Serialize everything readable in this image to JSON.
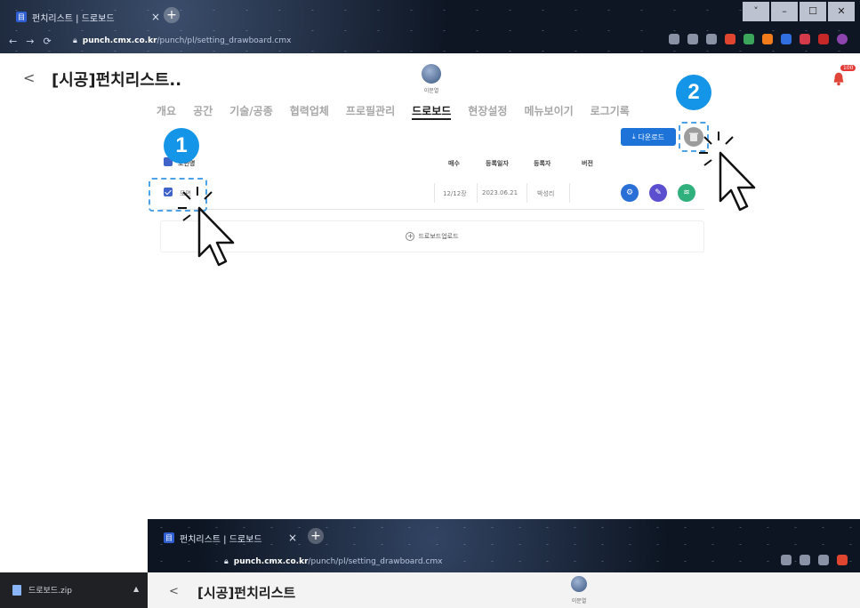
{
  "browser": {
    "tab_title": "펀치리스트 | 드로보드",
    "tab_close": "×",
    "new_tab": "+",
    "url_host": "punch.cmx.co.kr",
    "url_path": "/punch/pl/setting_drawboard.cmx",
    "window_controls": [
      "˅",
      "–",
      "☐",
      "✕"
    ]
  },
  "header": {
    "back": "<",
    "title": "[시공]펀치리스트..",
    "avatar_label": "이문열",
    "notification_badge": "100"
  },
  "tabs": [
    "개요",
    "공간",
    "기술/공종",
    "협력업체",
    "프로필관리",
    "드로보드",
    "현장설정",
    "메뉴보이기",
    "로그기록"
  ],
  "active_tab": "드로보드",
  "toolbar": {
    "download_label": "다운로드"
  },
  "table": {
    "headers": {
      "name": "도면명",
      "pages": "매수",
      "date": "등록일자",
      "author": "등록자",
      "version": "버전"
    },
    "rows": [
      {
        "name": "도면",
        "pages": "12/12장",
        "date": "2023.06.21",
        "author": "박성리",
        "version": ""
      }
    ],
    "upload_label": "드로보드업로드"
  },
  "annotations": {
    "step1": "1",
    "step2": "2"
  },
  "bottom_browser": {
    "tab_title": "펀치리스트 | 드로보드",
    "url_host": "punch.cmx.co.kr",
    "url_path": "/punch/pl/setting_drawboard.cmx",
    "title": "[시공]펀치리스트",
    "avatar_label": "이문열"
  },
  "download_shelf": {
    "file_name": "드로보드.zip"
  },
  "colors": {
    "primary": "#1e73d8",
    "badge": "#1595e8",
    "gear_action": "#2a6fd6",
    "edit_action": "#5b4fcf",
    "layers_action": "#2fb07c"
  }
}
